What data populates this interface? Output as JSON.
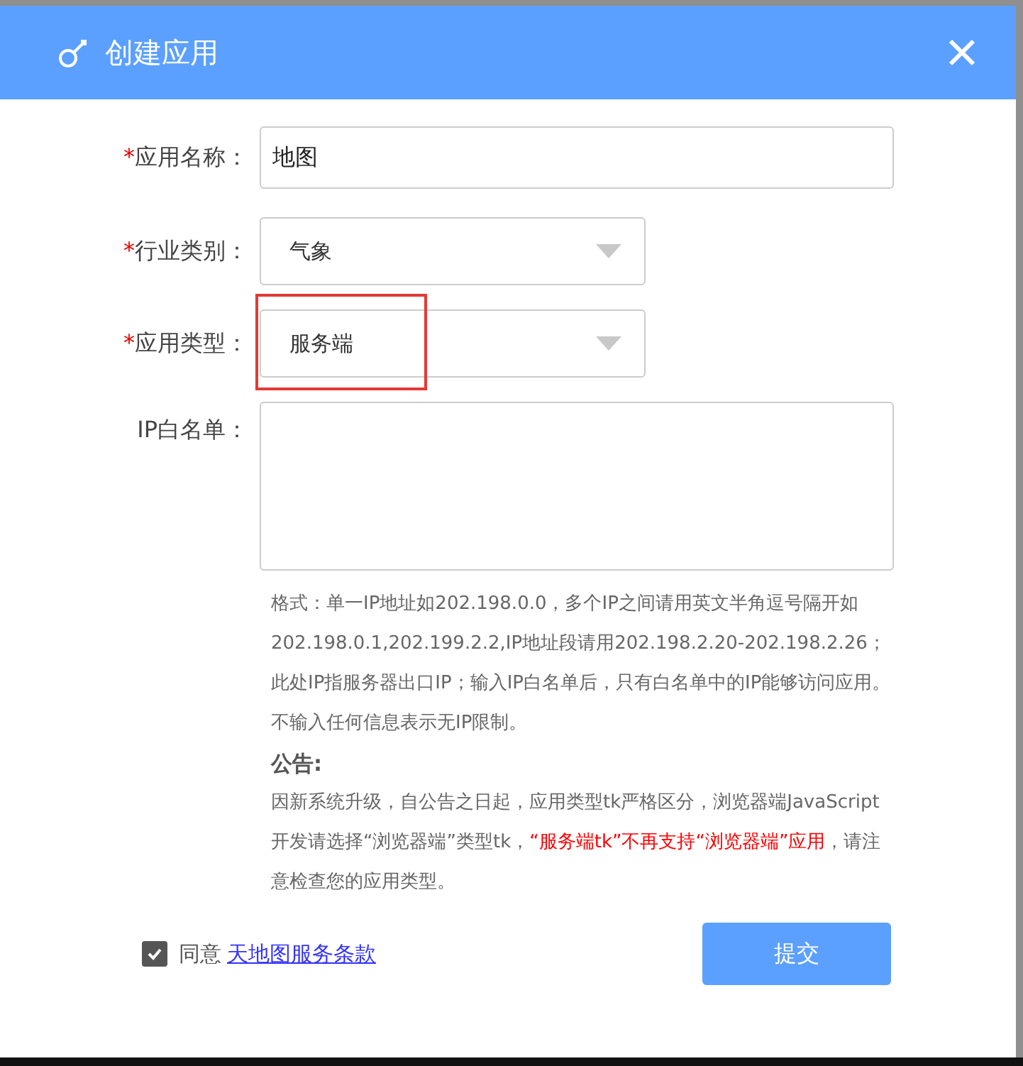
{
  "dialog": {
    "title": "创建应用"
  },
  "fields": [
    {
      "kind": "input",
      "marker": "*",
      "label": "应用名称：",
      "value": "地图",
      "highlighted": false
    },
    {
      "kind": "select",
      "marker": "*",
      "label": "行业类别：",
      "value": "气象",
      "highlighted": false
    },
    {
      "kind": "select",
      "marker": "*",
      "label": "应用类型：",
      "value": "服务端",
      "highlighted": true
    },
    {
      "kind": "textarea",
      "label": "IP白名单：",
      "highlighted": false
    }
  ],
  "help": [
    "格式：单一IP地址如202.198.0.0，多个IP之间请用英文半角逗号隔开如202.198.0.1,202.199.2.2,IP地址段请用202.198.2.20-202.198.2.26；此处IP指服务器出口IP；输入IP白名单后，只有白名单中的IP能够访问应用。",
    "不输入任何信息表示无IP限制。"
  ],
  "notice": {
    "heading": "公告:",
    "segments": [
      {
        "text": "因新系统升级，自公告之日起，应用类型tk严格区分，浏览器端JavaScript开发请选择“浏览器端”类型tk，",
        "emphasis": false
      },
      {
        "text": "“服务端tk”不再支持“浏览器端”应用",
        "emphasis": true
      },
      {
        "text": "，请注意检查您的应用类型。",
        "emphasis": false
      }
    ]
  },
  "agreement": {
    "checked": true,
    "text": "同意",
    "link": "天地图服务条款"
  },
  "submit": "提交"
}
